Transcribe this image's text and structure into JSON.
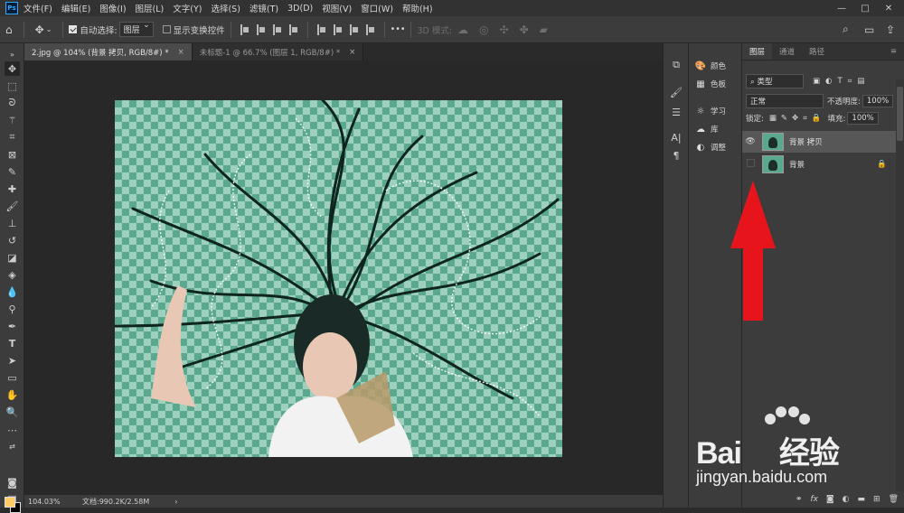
{
  "menubar": {
    "logo": "Ps",
    "items": [
      "文件(F)",
      "编辑(E)",
      "图像(I)",
      "图层(L)",
      "文字(Y)",
      "选择(S)",
      "滤镜(T)",
      "3D(D)",
      "视图(V)",
      "窗口(W)",
      "帮助(H)"
    ],
    "window_controls": [
      "—",
      "□",
      "✕"
    ]
  },
  "optionsbar": {
    "auto_select_label": "自动选择:",
    "auto_select_checked": true,
    "auto_select_value": "图层",
    "show_transform_label": "显示变换控件",
    "show_transform_checked": false,
    "more": "•••",
    "mode_3d_label": "3D 模式:"
  },
  "tabs": [
    {
      "label": "2.jpg @ 104% (背景 拷贝, RGB/8#) *",
      "active": true,
      "close": "×"
    },
    {
      "label": "未标题-1 @ 66.7% (图层 1, RGB/8#) *",
      "active": false,
      "close": "×"
    }
  ],
  "statusbar": {
    "zoom": "104.03%",
    "doc": "文档:990.2K/2.58M",
    "arrow": "›"
  },
  "panels": {
    "color": "颜色",
    "swatches": "色板",
    "learn": "学习",
    "libraries": "库",
    "adjustments": "调整"
  },
  "layers_panel": {
    "tabs": [
      "图层",
      "通道",
      "路径"
    ],
    "menu": "≡",
    "filter_type": "类型",
    "blend_mode": "正常",
    "opacity_label": "不透明度:",
    "opacity_value": "100%",
    "lock_label": "锁定:",
    "fill_label": "填充:",
    "fill_value": "100%",
    "layers": [
      {
        "name": "背景 拷贝",
        "visible": true,
        "active": true,
        "locked": false
      },
      {
        "name": "背景",
        "visible": false,
        "active": false,
        "locked": true
      }
    ],
    "bottom_icons": [
      "link-icon",
      "fx-icon",
      "mask-icon",
      "adjustment-icon",
      "group-icon",
      "new-layer-icon",
      "trash-icon"
    ]
  },
  "colors": {
    "foreground": "#ffcc66",
    "background": "#000000",
    "arrow": "#e8141b"
  },
  "watermark": {
    "brand": "Bai",
    "brand2": "经验",
    "url": "jingyan.baidu.com"
  }
}
